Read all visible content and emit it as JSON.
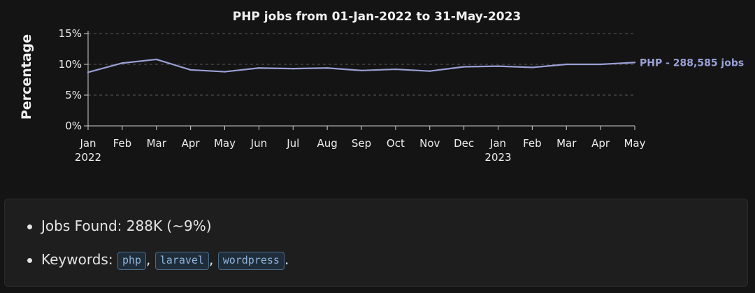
{
  "chart_data": {
    "type": "line",
    "title": "PHP jobs from 01-Jan-2022 to 31-May-2023",
    "xlabel": "",
    "ylabel": "Percentage",
    "ylim": [
      0,
      15
    ],
    "yticks": [
      "0%",
      "5%",
      "10%",
      "15%"
    ],
    "ytick_values": [
      0,
      5,
      10,
      15
    ],
    "categories": [
      "2022-01",
      "2022-02",
      "2022-03",
      "2022-04",
      "2022-05",
      "2022-06",
      "2022-07",
      "2022-08",
      "2022-09",
      "2022-10",
      "2022-11",
      "2022-12",
      "2023-01",
      "2023-02",
      "2023-03",
      "2023-04",
      "2023-05"
    ],
    "tick_labels": [
      "Jan",
      "Feb",
      "Mar",
      "Apr",
      "May",
      "Jun",
      "Jul",
      "Aug",
      "Sep",
      "Oct",
      "Nov",
      "Dec",
      "Jan",
      "Feb",
      "Mar",
      "Apr",
      "May"
    ],
    "tick_sublabels": [
      "2022",
      "",
      "",
      "",
      "",
      "",
      "",
      "",
      "",
      "",
      "",
      "",
      "2023",
      "",
      "",
      "",
      ""
    ],
    "grid": "horizontal-dashed",
    "series": [
      {
        "name": "PHP - 288,585 jobs",
        "color": "#9ba0d6",
        "values": [
          8.7,
          10.2,
          10.8,
          9.1,
          8.8,
          9.4,
          9.3,
          9.4,
          9.0,
          9.2,
          8.9,
          9.6,
          9.7,
          9.5,
          10.0,
          10.0,
          10.3
        ]
      }
    ]
  },
  "info": {
    "jobs_found": "Jobs Found: 288K (~9%)",
    "keywords_label": "Keywords:",
    "keywords": [
      "php",
      "laravel",
      "wordpress"
    ],
    "separator": ",",
    "terminator": "."
  }
}
